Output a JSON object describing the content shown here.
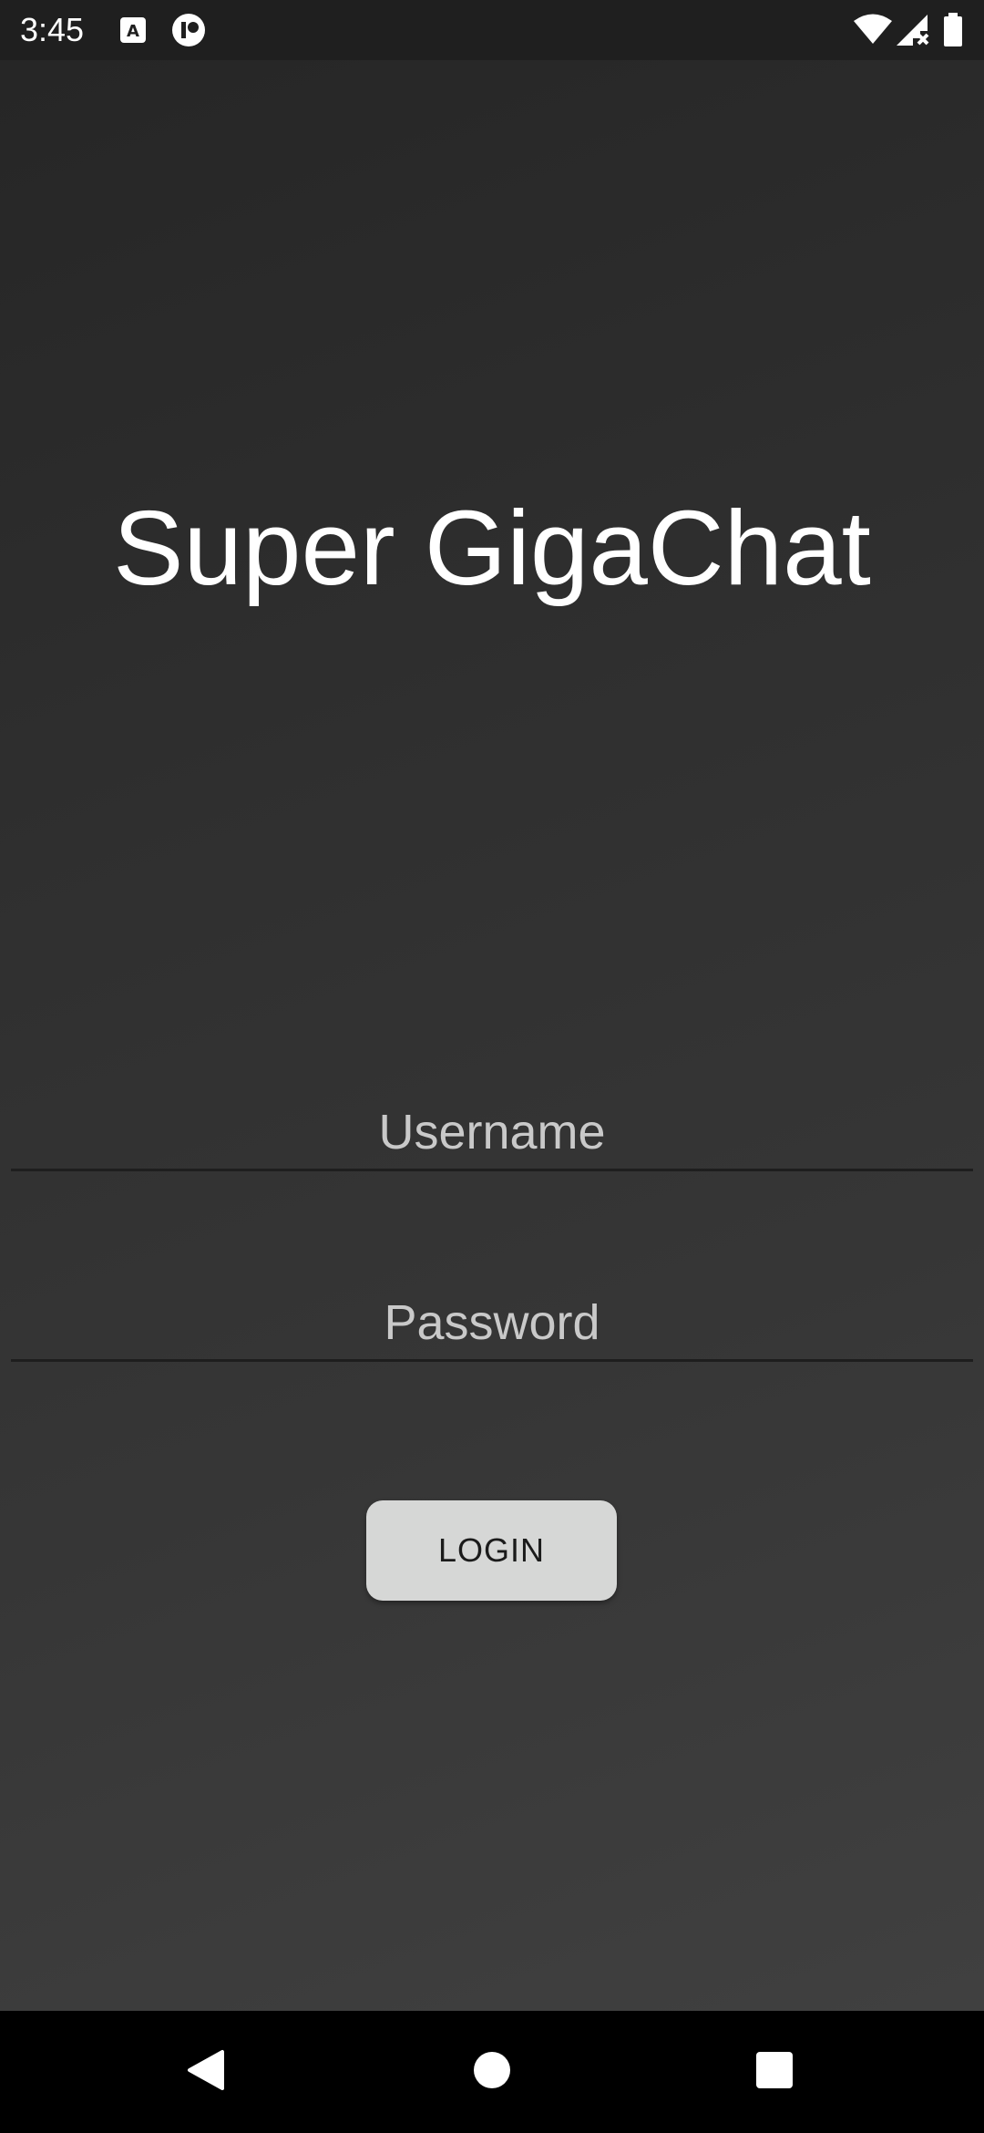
{
  "status_bar": {
    "time": "3:45",
    "left_icons": [
      "keyboard-a-icon",
      "app-notification-icon"
    ],
    "right_icons": [
      "wifi-icon",
      "cellular-no-signal-icon",
      "battery-icon"
    ]
  },
  "app": {
    "title": "Super GigaChat",
    "username_placeholder": "Username",
    "username_value": "",
    "password_placeholder": "Password",
    "password_value": "",
    "login_label": "LOGIN"
  },
  "nav_bar": {
    "buttons": [
      "back-icon",
      "home-icon",
      "recents-icon"
    ]
  },
  "colors": {
    "status_bar_bg": "#1f1f1f",
    "screen_bg_top": "#262626",
    "screen_bg_bottom": "#404040",
    "title_text": "#ffffff",
    "placeholder_text": "#c9c9c9",
    "button_bg": "#d6d7d6",
    "button_text": "#1b1b1b",
    "nav_bar_bg": "#000000"
  }
}
